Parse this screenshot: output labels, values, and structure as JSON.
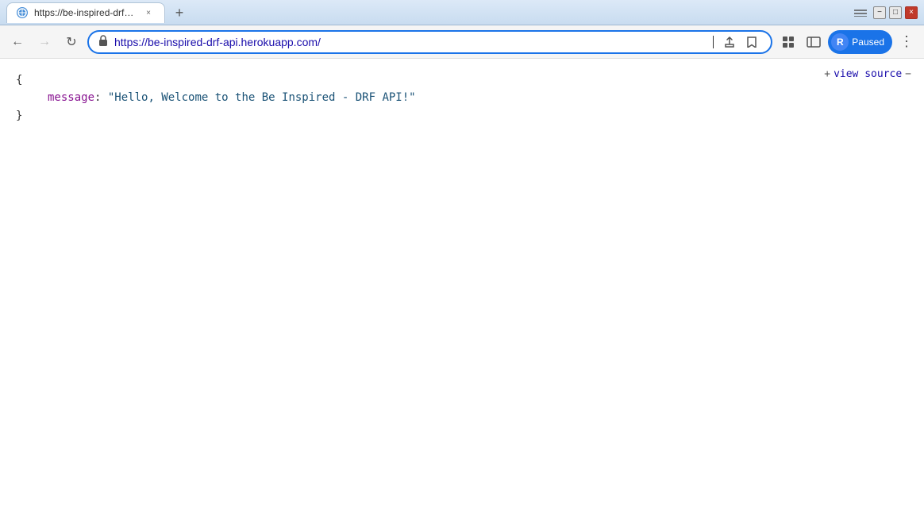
{
  "window": {
    "title": "https://be-inspired-drf-api.herok",
    "minimize_label": "−",
    "maximize_label": "□",
    "close_label": "×"
  },
  "tab": {
    "favicon_letter": "🌐",
    "title": "https://be-inspired-drf-api.herok",
    "close_label": "×"
  },
  "new_tab": {
    "label": "+"
  },
  "overflow": {
    "label": "⌄"
  },
  "nav": {
    "back_label": "←",
    "forward_label": "→",
    "reload_label": "↻"
  },
  "address_bar": {
    "url": "https://be-inspired-drf-api.herokuapp.com/",
    "lock_icon": "🔒"
  },
  "address_actions": {
    "share_label": "⬆",
    "star_label": "☆"
  },
  "toolbar": {
    "extensions_label": "🧩",
    "profile_label": "👤",
    "menu_label": "⋮"
  },
  "profile": {
    "initial": "R",
    "status": "Paused"
  },
  "view_source": {
    "plus": "+",
    "label": "view source",
    "dash": "−"
  },
  "json_content": {
    "open_brace": "{",
    "key": "message",
    "colon": ":",
    "value": "\"Hello, Welcome to the Be Inspired - DRF API!\"",
    "close_brace": "}"
  }
}
